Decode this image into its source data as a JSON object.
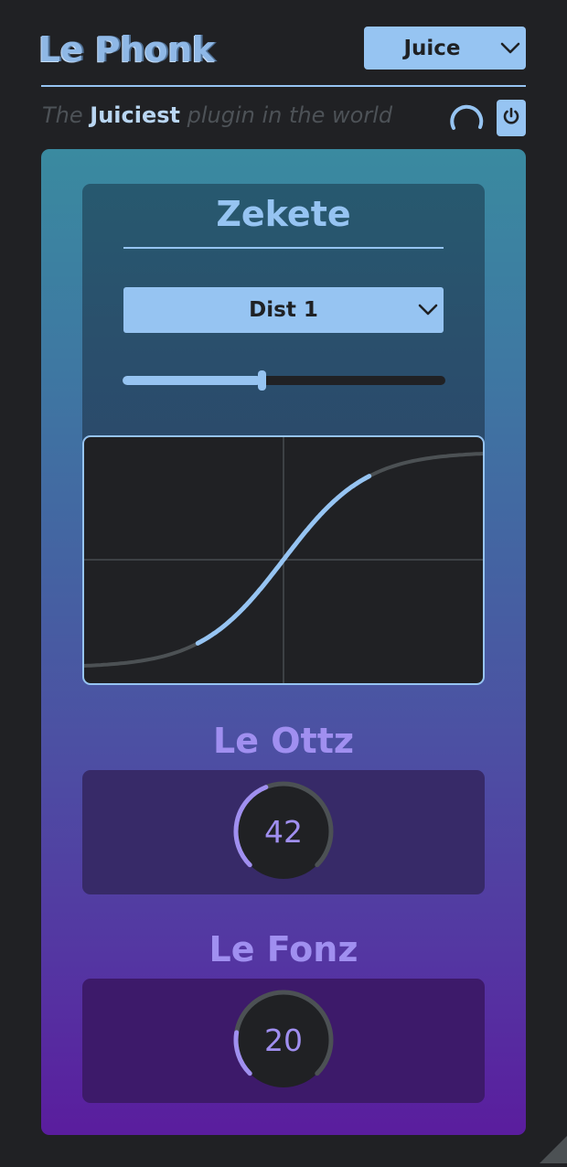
{
  "header": {
    "logo_text": "Le Phonk",
    "preset": {
      "selected": "Juice"
    },
    "tagline": {
      "before": "The",
      "strong": "Juiciest",
      "after": "plugin in the world"
    }
  },
  "distortion": {
    "title": "Zekete",
    "mode": {
      "selected": "Dist 1"
    },
    "drive": 0.43
  },
  "ottz": {
    "title": "Le Ottz",
    "value": "42",
    "level": 0.42
  },
  "fonz": {
    "title": "Le Fonz",
    "value": "20",
    "level": 0.2
  },
  "colors": {
    "background": "#202124",
    "accent": "#96c4f2",
    "knob_accent": "#a08ff0",
    "track": "#4c5154"
  },
  "icons": {
    "preset_chevron": "chevron-down-icon",
    "mode_chevron": "chevron-down-icon",
    "loading": "spinner-icon",
    "power": "power-icon"
  }
}
